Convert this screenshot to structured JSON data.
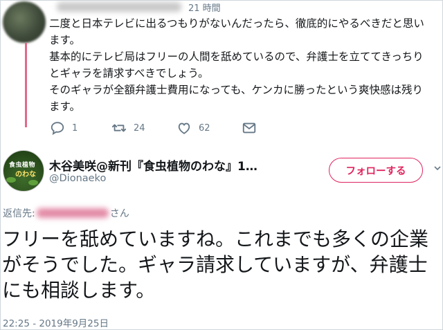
{
  "parent_tweet": {
    "time": "21 時間",
    "lines": [
      "二度と日本テレビに出るつもりがないんだったら、徹底的にやるべきだと思い",
      "ます。",
      "基本的にテレビ局はフリーの人間を舐めているので、弁護士を立ててきっちり",
      "とギャラを請求すべきでしょう。",
      "そのギャラが全額弁護士費用になっても、ケンカに勝ったという爽快感は残り",
      "ます。"
    ],
    "actions": {
      "reply_count": "1",
      "retweet_count": "24",
      "like_count": "62"
    }
  },
  "main_tweet": {
    "display_name": "木谷美咲@新刊『食虫植物のわな』1…",
    "handle": "@Dionaeko",
    "follow_label": "フォローする",
    "avatar_text": [
      "食虫植物",
      "のわな"
    ],
    "reply_to_prefix": "返信先:",
    "reply_to_suffix": "さん",
    "text": "フリーを舐めていますね。これまでも多くの企業がそうでした。ギャラ請求していますが、弁護士にも相談します。",
    "timestamp": "22:25 - 2019年9月25日"
  },
  "colors": {
    "accent": "#e0245e",
    "thread_line": "#e2688a",
    "muted": "#657786",
    "text": "#14171a"
  },
  "icons": [
    "reply-icon",
    "retweet-icon",
    "like-icon",
    "message-icon",
    "chevron-down-icon"
  ]
}
